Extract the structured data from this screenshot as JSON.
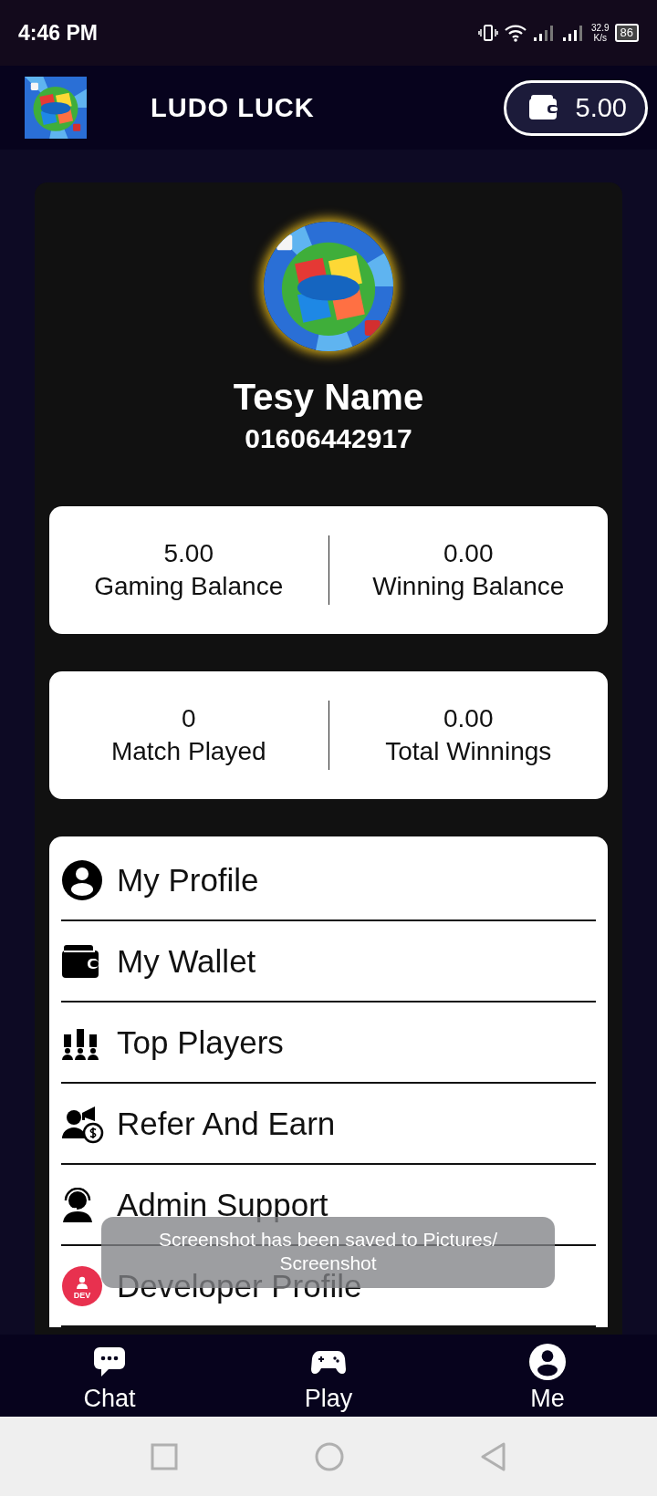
{
  "status_bar": {
    "time": "4:46 PM",
    "net_speed": "32.9",
    "net_unit": "K/s",
    "battery": "86"
  },
  "header": {
    "title": "LUDO LUCK",
    "wallet_amount": "5.00"
  },
  "profile": {
    "name": "Tesy Name",
    "phone": "01606442917"
  },
  "stats": [
    {
      "items": [
        {
          "value": "5.00",
          "label": "Gaming Balance"
        },
        {
          "value": "0.00",
          "label": "Winning Balance"
        }
      ]
    },
    {
      "items": [
        {
          "value": "0",
          "label": "Match Played"
        },
        {
          "value": "0.00",
          "label": "Total Winnings"
        }
      ]
    }
  ],
  "menu": [
    {
      "label": "My Profile"
    },
    {
      "label": "My Wallet"
    },
    {
      "label": "Top Players"
    },
    {
      "label": "Refer And Earn"
    },
    {
      "label": "Admin Support"
    },
    {
      "label": "Developer Profile",
      "badge": "DEV"
    }
  ],
  "toast": {
    "message": "Screenshot has been saved to  Pictures/ Screenshot"
  },
  "bottom_nav": [
    {
      "label": "Chat"
    },
    {
      "label": "Play"
    },
    {
      "label": "Me"
    }
  ]
}
